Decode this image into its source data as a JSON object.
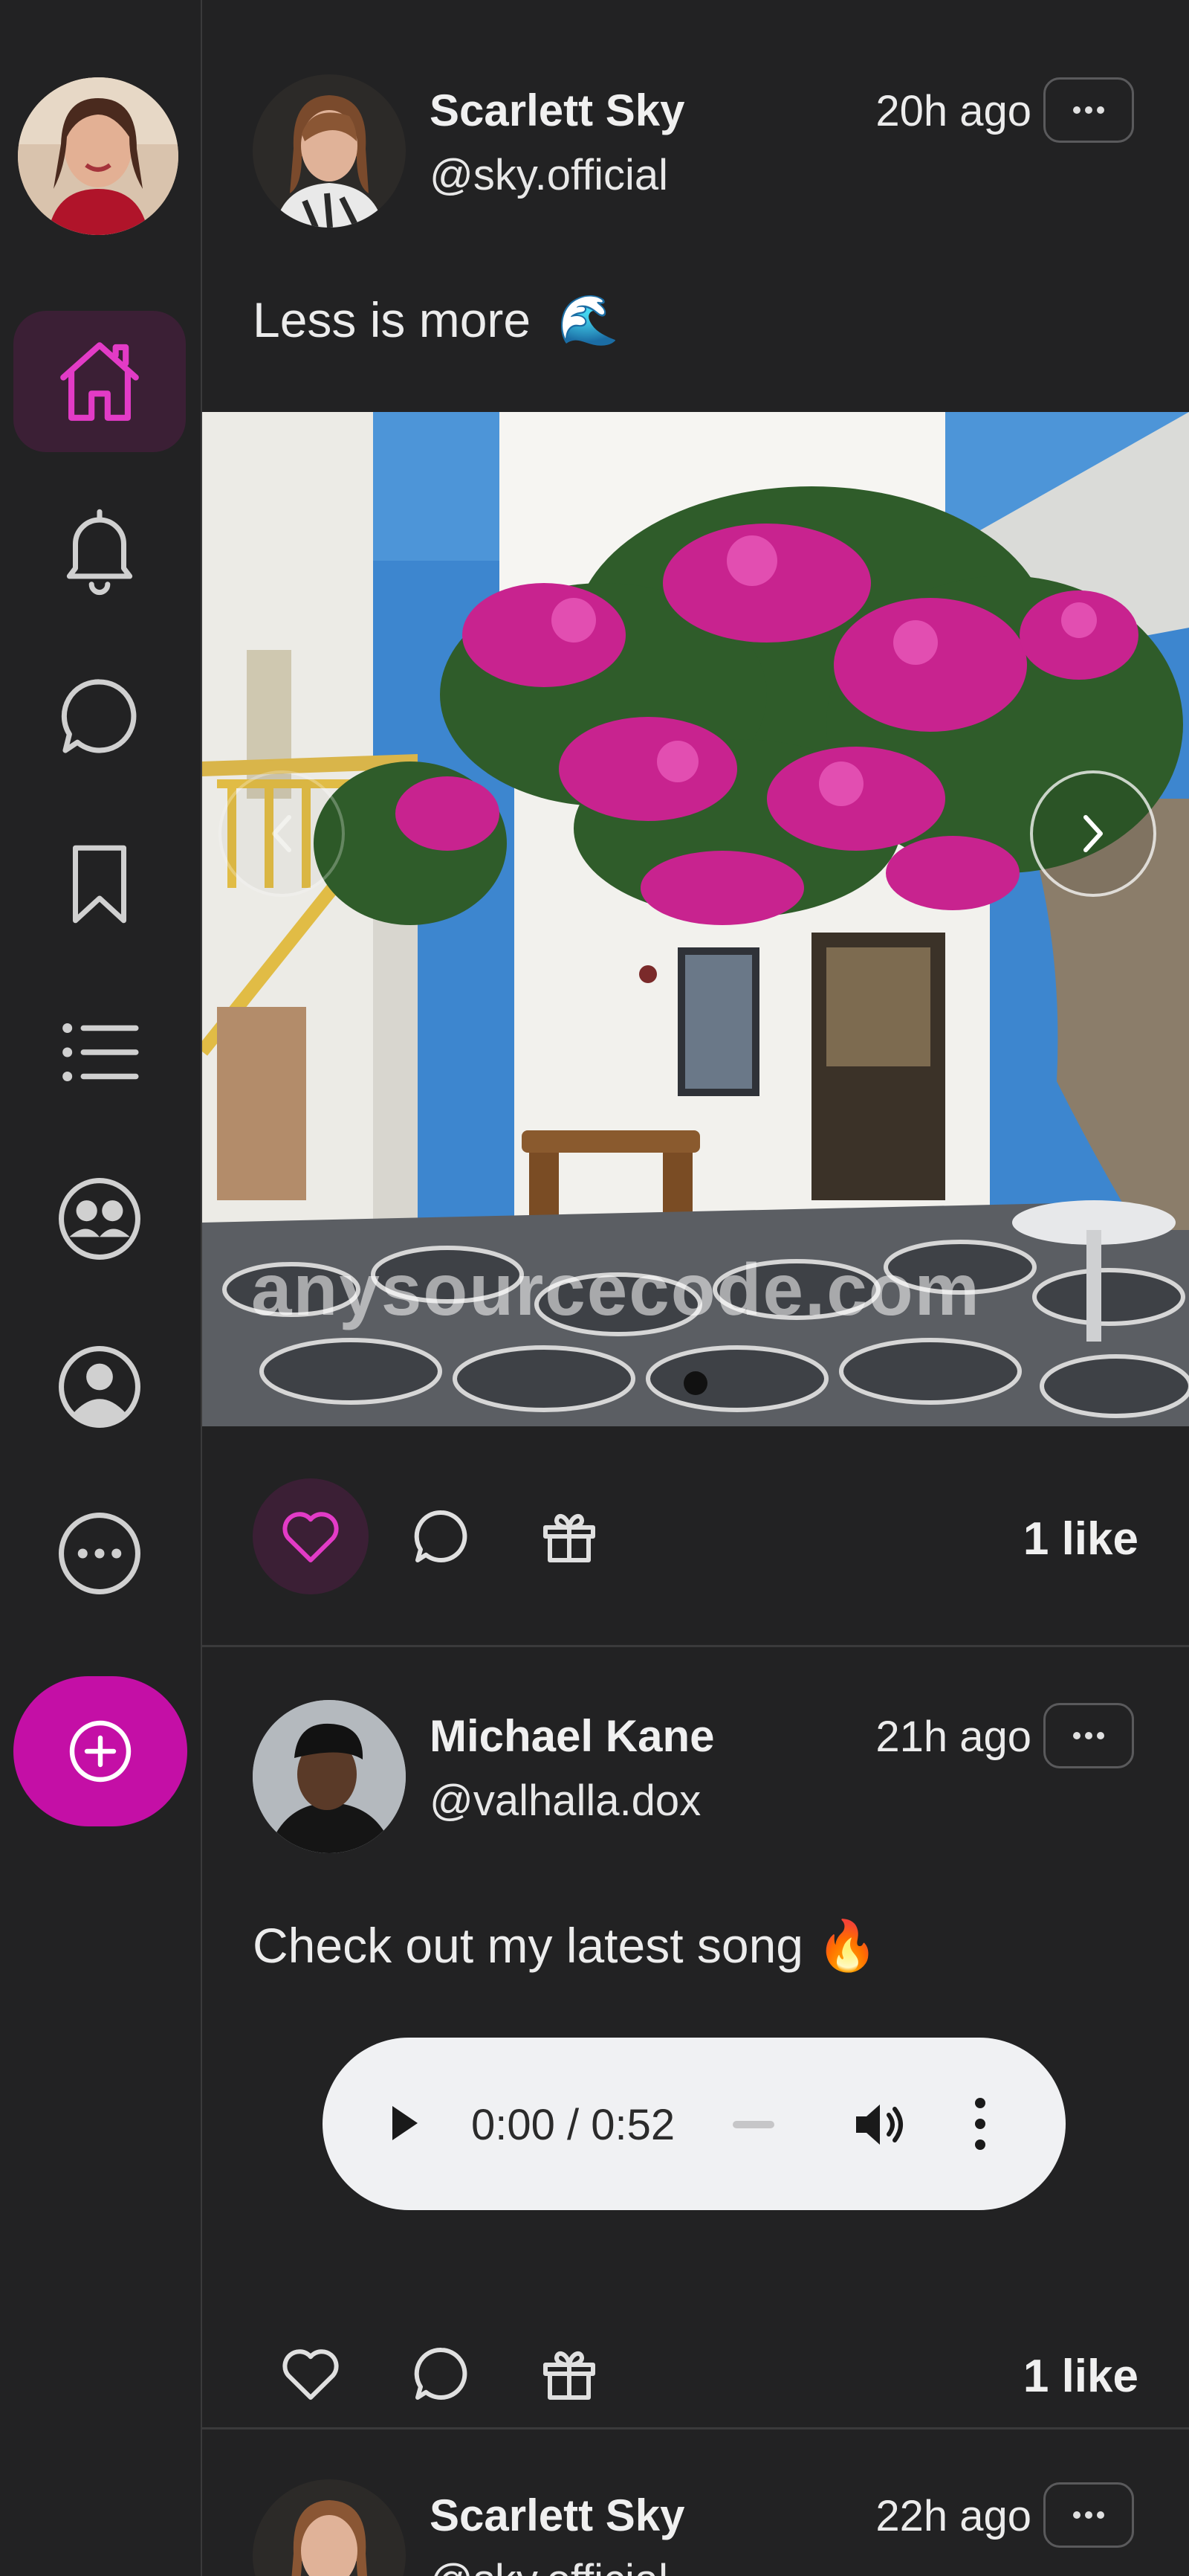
{
  "sidebar": {
    "nav": [
      {
        "name": "home",
        "active": true
      },
      {
        "name": "notifications",
        "active": false
      },
      {
        "name": "messages",
        "active": false
      },
      {
        "name": "bookmarks",
        "active": false
      },
      {
        "name": "lists",
        "active": false
      },
      {
        "name": "communities",
        "active": false
      },
      {
        "name": "profile",
        "active": false
      },
      {
        "name": "more",
        "active": false
      }
    ],
    "create_icon": "plus-circle-icon"
  },
  "posts": [
    {
      "name": "Scarlett Sky",
      "handle": "@sky.official",
      "time": "20h ago",
      "text": "Less is more",
      "emoji": "🌊",
      "media": {
        "type": "image",
        "watermark": "anysourcecode.com",
        "slide_index": 1
      },
      "liked": true,
      "likes": "1 like"
    },
    {
      "name": "Michael Kane",
      "handle": "@valhalla.dox",
      "time": "21h ago",
      "text": "Check out my latest song",
      "emoji": "🔥",
      "audio": {
        "time": "0:00 / 0:52"
      },
      "liked": false,
      "likes": "1 like"
    },
    {
      "name": "Scarlett Sky",
      "handle": "@sky.official",
      "time": "22h ago"
    }
  ],
  "colors": {
    "background": "#222223",
    "accent": "#c40fa6",
    "accent_icon": "#e23bc6",
    "active_bg": "#3b1f35",
    "divider": "#3a3a3b"
  }
}
